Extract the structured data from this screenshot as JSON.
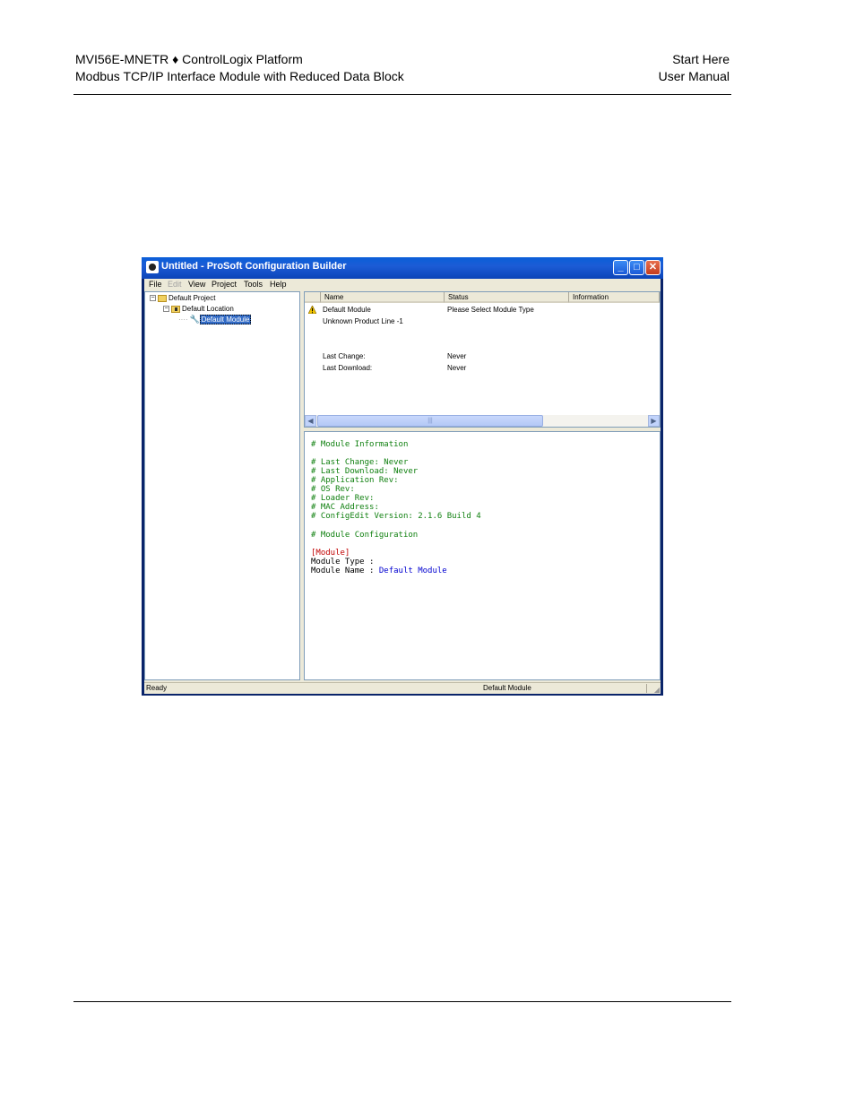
{
  "page_header": {
    "left_line1": "MVI56E-MNETR ♦ ControlLogix Platform",
    "left_line2": "Modbus TCP/IP Interface Module with Reduced Data Block",
    "right_line1": "Start Here",
    "right_line2": "User Manual"
  },
  "window": {
    "title": "Untitled - ProSoft Configuration Builder",
    "menu": [
      "File",
      "Edit",
      "View",
      "Project",
      "Tools",
      "Help"
    ],
    "tree": {
      "project": "Default Project",
      "location": "Default Location",
      "module": "Default Module"
    },
    "list": {
      "columns": [
        "Name",
        "Status",
        "Information"
      ],
      "rows": [
        {
          "name": "Default Module",
          "status": "Please Select Module Type"
        },
        {
          "name": "Unknown Product Line -1",
          "status": ""
        },
        {
          "name": "Last Change:",
          "status": "Never"
        },
        {
          "name": "Last Download:",
          "status": "Never"
        }
      ]
    },
    "text_lines": [
      "# Module Information",
      "# Last Change: Never",
      "# Last Download: Never",
      "# Application Rev:",
      "# OS Rev:",
      "# Loader Rev:",
      "# MAC Address:",
      "# ConfigEdit Version: 2.1.6 Build 4",
      "# Module Configuration",
      "[Module]",
      "Module Type :",
      "Module Name : ",
      "Default Module"
    ],
    "status_left": "Ready",
    "status_right": "Default Module",
    "colors": {
      "comment": "#108010",
      "section": "#c00000",
      "value": "#0000d0",
      "titlebar": "#0a5fd8"
    }
  }
}
